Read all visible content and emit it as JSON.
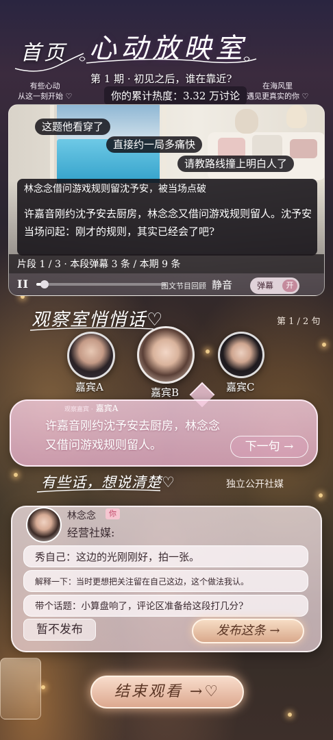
{
  "header": {
    "nav_home": "首页",
    "show_title": "心动放映室",
    "tag_left_line1": "有些心动",
    "tag_left_line2": "从这一刻开始 ♡",
    "tag_right_line1": "在海风里",
    "tag_right_line2": "遇见更真实的你 ♡",
    "episode": "第 1 期 · 初见之后，谁在靠近?",
    "heat_label": "你的累计热度：3.32 万讨论"
  },
  "player": {
    "danmaku": [
      "这题他看穿了",
      "直接约一局多痛快",
      "请教路线撞上明白人了"
    ],
    "dialog_head": "林念念借问游戏规则留沈予安，被当场点破",
    "dialog_text": "许嘉音刚约沈予安去厨房，林念念又借问游戏规则留人。沈予安当场问起：刚才的规则，其实已经会了吧?",
    "segment_info": "片段 1 / 3 · 本段弹幕 3 条 / 本期 9 条",
    "pause_glyph": "II",
    "progress": 0.04,
    "review_label": "图文节目回顾",
    "mute_label": "静音",
    "danmu_label": "弹幕",
    "danmu_state": "开"
  },
  "observation": {
    "title": "观察室悄悄话♡",
    "sentence_count": "第 1 / 2 句",
    "guests": [
      {
        "name": "嘉宾A"
      },
      {
        "name": "嘉宾B"
      },
      {
        "name": "嘉宾C"
      }
    ],
    "speaker_prefix": "观察嘉宾 ·",
    "speaker": "嘉宾A",
    "line": "许嘉音刚约沈予安去厨房，林念念又借问游戏规则留人。",
    "next_label": "下一句 →"
  },
  "social": {
    "title": "有些话，想说清楚♡",
    "media_label": "独立公开社媒",
    "user_name": "林念念",
    "you_badge": "你",
    "action": "经营社媒:",
    "options": [
      "秀自己：这边的光刚刚好，拍一张。",
      "解释一下：当时更想把关注留在自己这边，这个做法我认。",
      "带个话题：小算盘响了，评论区准备给这段打几分?"
    ],
    "hold_label": "暂不发布",
    "publish_label": "发布这条 →"
  },
  "footer": {
    "end_label": "结束观看 →♡"
  },
  "colors": {
    "bubble_pink": "#e8b0cc",
    "button_gold": "#dca88f",
    "badge_red": "#c04a6a"
  }
}
